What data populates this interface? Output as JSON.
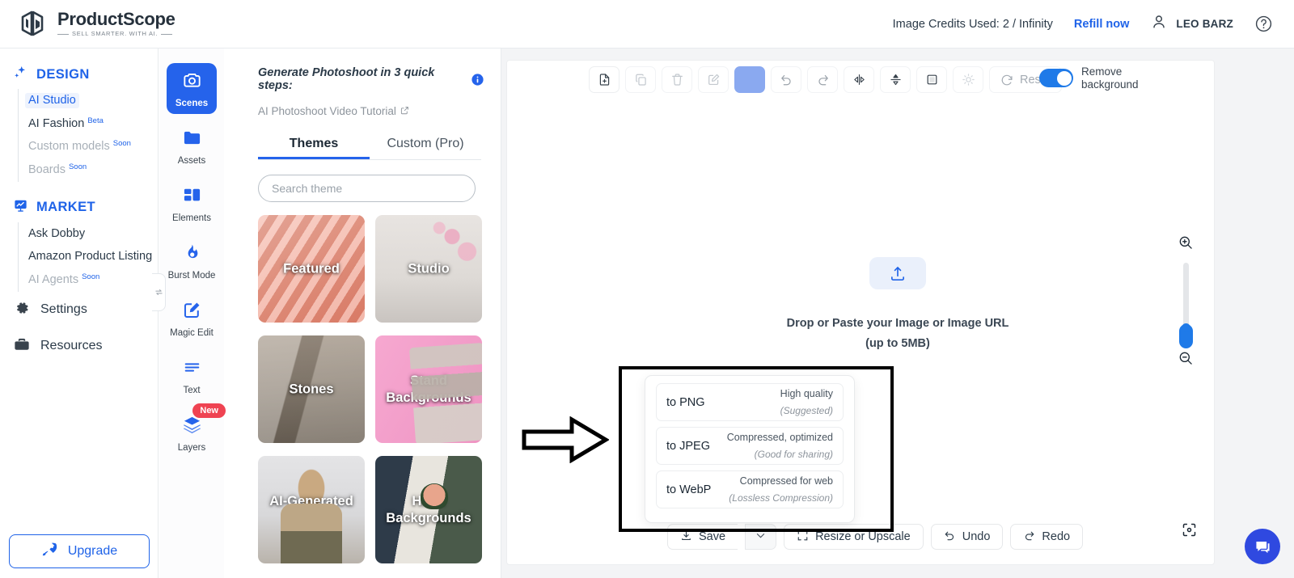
{
  "brand": {
    "name": "ProductScope",
    "tagline": "SELL SMARTER. WITH AI."
  },
  "topbar": {
    "credits": "Image Credits Used: 2 / Infinity",
    "refill": "Refill now",
    "user": "LEO BARZ"
  },
  "sidebar": {
    "groups": [
      {
        "label": "DESIGN",
        "items": [
          {
            "label": "AI Studio",
            "sup": "",
            "state": "active"
          },
          {
            "label": "AI Fashion",
            "sup": "Beta",
            "state": "normal"
          },
          {
            "label": "Custom models",
            "sup": "Soon",
            "state": "muted"
          },
          {
            "label": "Boards",
            "sup": "Soon",
            "state": "muted"
          }
        ]
      },
      {
        "label": "MARKET",
        "items": [
          {
            "label": "Ask Dobby",
            "sup": "",
            "state": "normal"
          },
          {
            "label": "Amazon Product Listing",
            "sup": "",
            "state": "normal"
          },
          {
            "label": "AI Agents",
            "sup": "Soon",
            "state": "muted"
          }
        ]
      }
    ],
    "roots": [
      {
        "label": "Settings"
      },
      {
        "label": "Resources"
      }
    ],
    "upgrade": "Upgrade"
  },
  "rail": [
    {
      "label": "Scenes",
      "icon": "camera-icon",
      "active": true,
      "badge": ""
    },
    {
      "label": "Assets",
      "icon": "folder-icon",
      "active": false,
      "badge": ""
    },
    {
      "label": "Elements",
      "icon": "elements-icon",
      "active": false,
      "badge": ""
    },
    {
      "label": "Burst Mode",
      "icon": "flame-icon",
      "active": false,
      "badge": ""
    },
    {
      "label": "Magic Edit",
      "icon": "magic-edit-icon",
      "active": false,
      "badge": ""
    },
    {
      "label": "Text",
      "icon": "text-icon",
      "active": false,
      "badge": ""
    },
    {
      "label": "Layers",
      "icon": "layers-icon",
      "active": false,
      "badge": "New"
    }
  ],
  "panel": {
    "title": "Generate Photoshoot in 3 quick steps:",
    "tutorial": "AI Photoshoot Video Tutorial",
    "tabs": [
      {
        "label": "Themes",
        "active": true
      },
      {
        "label": "Custom (Pro)",
        "active": false
      }
    ],
    "search_placeholder": "Search theme",
    "search_value": "",
    "cards": [
      {
        "label": "Featured",
        "bg": "bg-featured"
      },
      {
        "label": "Studio",
        "bg": "bg-studio"
      },
      {
        "label": "Stones",
        "bg": "bg-stones"
      },
      {
        "label": "Stand Backgrounds",
        "bg": "bg-stand"
      },
      {
        "label": "AI-Generated Models",
        "bg": "bg-models"
      },
      {
        "label": "Hand Backgrounds",
        "bg": "bg-hand"
      }
    ]
  },
  "canvas": {
    "toolbar": [
      {
        "name": "new-file-button",
        "icon": "file-plus-icon"
      },
      {
        "name": "duplicate-button",
        "icon": "copy-icon"
      },
      {
        "name": "delete-button",
        "icon": "trash-icon"
      },
      {
        "name": "edit-button",
        "icon": "pencil-square-icon"
      },
      {
        "name": "color-swatch-button",
        "icon": "color-swatch-icon"
      },
      {
        "name": "undo-button",
        "icon": "rotate-left-icon"
      },
      {
        "name": "redo-button",
        "icon": "rotate-right-icon"
      },
      {
        "name": "flip-horizontal-button",
        "icon": "flip-horizontal-icon"
      },
      {
        "name": "flip-vertical-button",
        "icon": "flip-vertical-icon"
      },
      {
        "name": "shadow-button",
        "icon": "square-icon"
      },
      {
        "name": "brightness-button",
        "icon": "sun-icon"
      }
    ],
    "reset_label": "Reset",
    "toggle_label_line1": "Remove",
    "toggle_label_line2": "background",
    "toggle_on": true,
    "drop_line1": "Drop or Paste your Image or Image URL",
    "drop_line2": "(up to 5MB)"
  },
  "export_menu": [
    {
      "name": "to PNG",
      "d1": "High quality",
      "d2": "(Suggested)"
    },
    {
      "name": "to JPEG",
      "d1": "Compressed, optimized",
      "d2": "(Good for sharing)"
    },
    {
      "name": "to WebP",
      "d1": "Compressed for web",
      "d2": "(Lossless Compression)"
    }
  ],
  "actions": {
    "save": "Save",
    "resize": "Resize or Upscale",
    "undo": "Undo",
    "redo": "Redo"
  },
  "colors": {
    "accent": "#1f63e8",
    "rail_active": "#2563eb",
    "badge_new": "#ef4352",
    "toggle_on": "#1f7ae8",
    "chat": "#2f49e0"
  }
}
